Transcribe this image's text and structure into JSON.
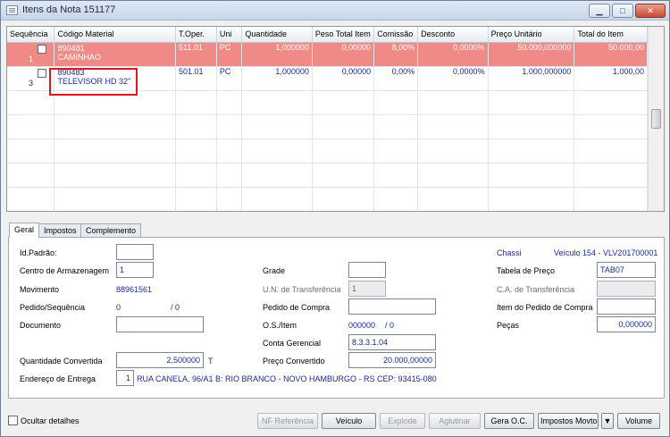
{
  "window": {
    "title": "Itens da Nota 151177",
    "min_label": "▁",
    "max_label": "□",
    "close_label": "✕"
  },
  "grid": {
    "columns": [
      "Sequência",
      "Código Material",
      "T.Oper.",
      "Uni",
      "Quantidade",
      "Peso Total Item",
      "Comissão",
      "Desconto",
      "Preço Unitário",
      "Total do Item"
    ],
    "rows": [
      {
        "seq": "1",
        "code": "890481",
        "desc": "CAMINHAO",
        "toper": "511.01",
        "uni": "PC",
        "quantidade": "1,000000",
        "peso": "0,00000",
        "comissao": "8,00%",
        "desconto": "0,0000%",
        "preco": "50.000,000000",
        "total": "50.000,00"
      },
      {
        "seq": "3",
        "code": "890483",
        "desc": "TELEVISOR HD 32\"",
        "toper": "501.01",
        "uni": "PC",
        "quantidade": "1,000000",
        "peso": "0,00000",
        "comissao": "0,00%",
        "desconto": "0,0000%",
        "preco": "1.000,000000",
        "total": "1.000,00"
      }
    ]
  },
  "tabs": [
    "Geral",
    "Impostos",
    "Complemento"
  ],
  "form": {
    "id_padrao": {
      "label": "Id.Padrão:",
      "value": ""
    },
    "centro": {
      "label": "Centro de Armazenagem",
      "value": "1"
    },
    "movimento": {
      "label": "Movimento",
      "value": "88961561"
    },
    "pedido_seq": {
      "label": "Pedido/Sequência",
      "value1": "0",
      "value2": "/ 0"
    },
    "documento": {
      "label": "Documento",
      "value": ""
    },
    "qtd_convertida": {
      "label": "Quantidade Convertida",
      "value": "2,500000",
      "unit": "T"
    },
    "endereco": {
      "label": "Endereço de Entrega",
      "num": "1",
      "value": "RUA CANELA, 96/A1 B: RIO BRANCO - NOVO HAMBURGO - RS CEP: 93415-080"
    },
    "grade": {
      "label": "Grade",
      "value": ""
    },
    "un_transf": {
      "label": "U.N. de Transferência",
      "value": "1"
    },
    "pedido_compra": {
      "label": "Pedido de Compra",
      "value": ""
    },
    "os_item": {
      "label": "O.S./Item",
      "value1": "000000",
      "value2": "/ 0"
    },
    "conta_gerencial": {
      "label": "Conta Gerencial",
      "value": "8.3.3.1.04"
    },
    "preco_convertido": {
      "label": "Preço Convertido",
      "value": "20.000,00000"
    },
    "chassi": {
      "label": "Chassi",
      "value": "Veículo 154 - VLV201700001"
    },
    "tabela_preco": {
      "label": "Tabela de Preço",
      "value": "TAB07"
    },
    "ca_transf": {
      "label": "C.A. de Transferência",
      "value": ""
    },
    "item_pedido_compra": {
      "label": "Item do Pedido de Compra",
      "value": ""
    },
    "pecas": {
      "label": "Peças",
      "value": "0,000000"
    }
  },
  "bottom": {
    "ocultar": "Ocultar detalhes",
    "nf_ref": "NF Referência",
    "veiculo": "Veículo",
    "explode": "Explode",
    "aglutinar": "Aglutinar",
    "gera_oc": "Gera O.C.",
    "impostos_movto": "Impostos Movto",
    "dropdown": "▼",
    "volume": "Volume"
  },
  "colors": {
    "selected_row": "#f08a86",
    "text_blue": "#1a2a9a",
    "highlight": "#e0141e"
  },
  "icons": {
    "app": "document-list-icon",
    "min": "minimize-icon",
    "max": "maximize-icon",
    "close": "close-icon"
  }
}
